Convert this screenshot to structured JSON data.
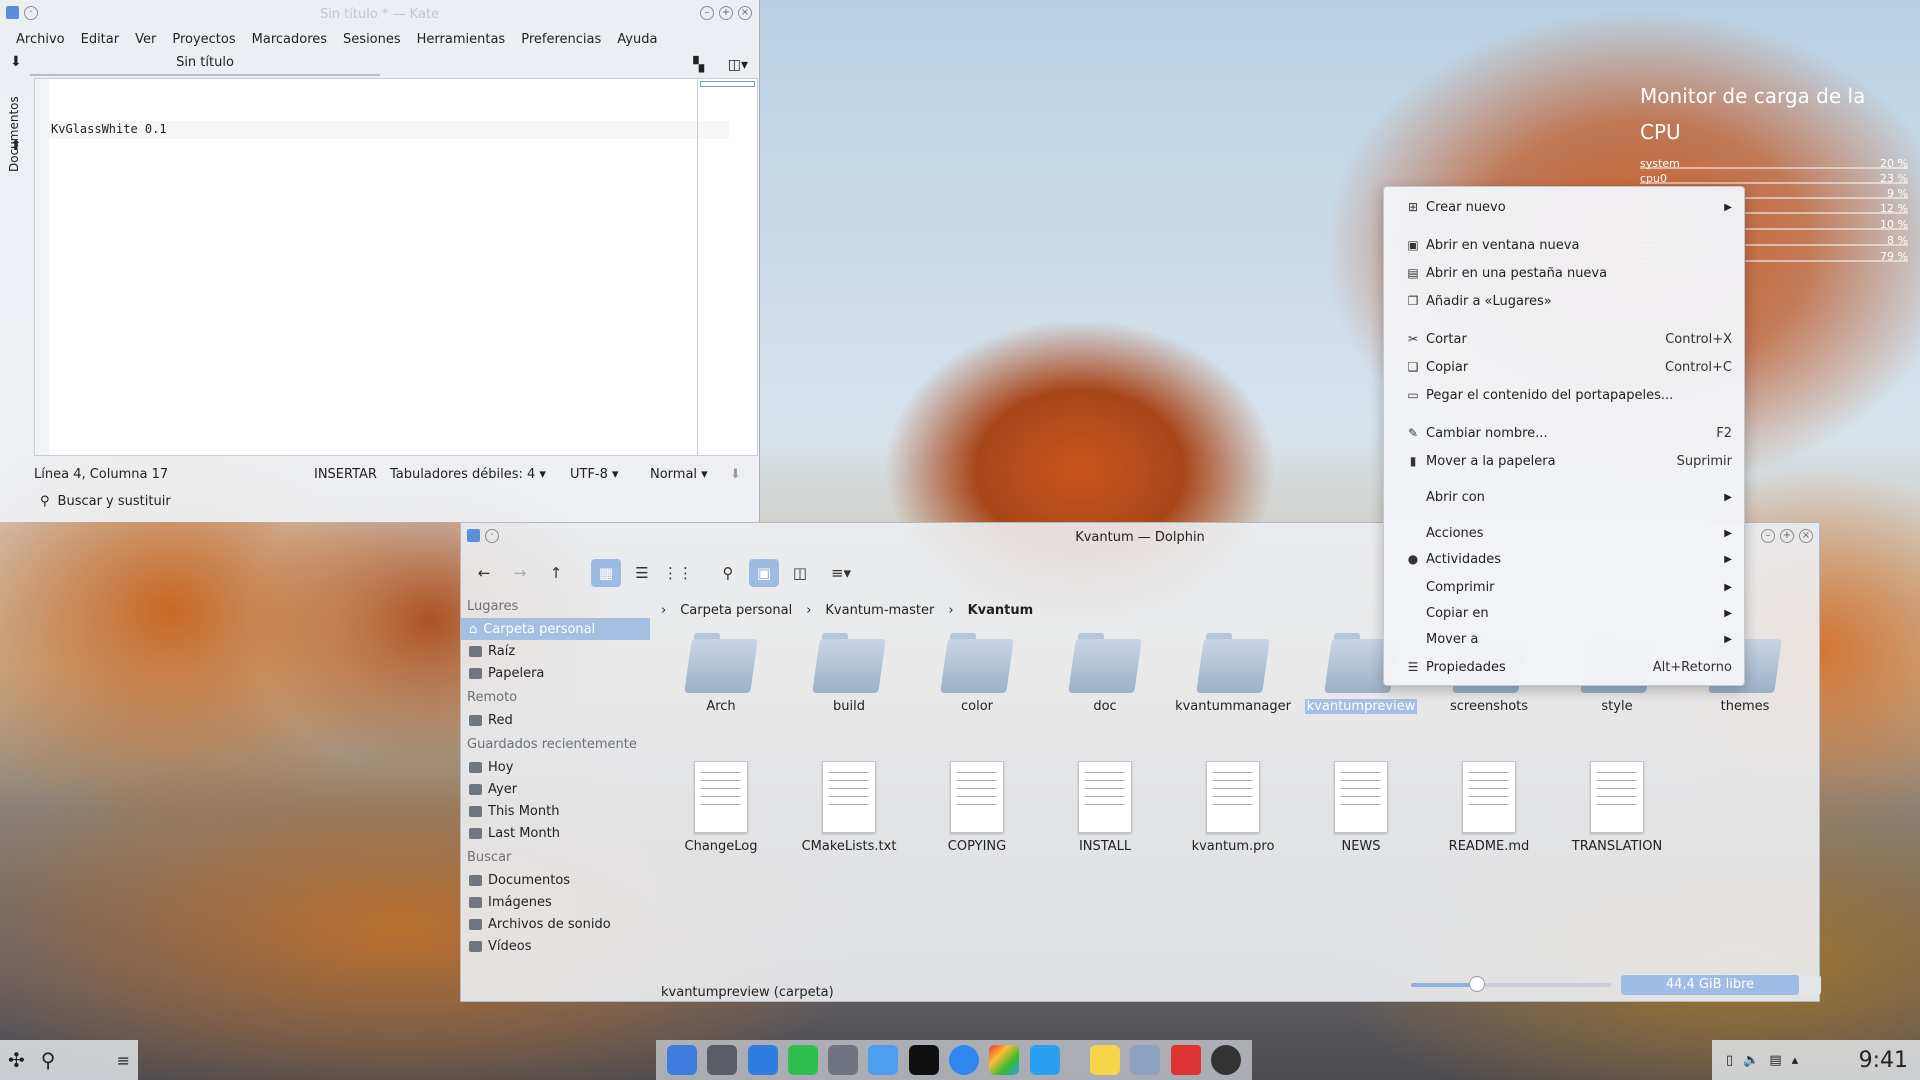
{
  "kate": {
    "title": "Sin título * — Kate",
    "menu": [
      "Archivo",
      "Editar",
      "Ver",
      "Proyectos",
      "Marcadores",
      "Sesiones",
      "Herramientas",
      "Preferencias",
      "Ayuda"
    ],
    "tab": "Sin título",
    "side_label": "Documentos",
    "code": "KvGlassWhite 0.1",
    "status": {
      "position": "Línea 4, Columna 17",
      "mode": "INSERTAR",
      "tabs": "Tabuladores débiles: 4",
      "encoding": "UTF-8",
      "syntax": "Normal"
    },
    "find": "Buscar y sustituir"
  },
  "dolphin": {
    "title": "Kvantum — Dolphin",
    "places": {
      "lugares_hdr": "Lugares",
      "lugares": [
        "Carpeta personal",
        "Raíz",
        "Papelera"
      ],
      "remoto_hdr": "Remoto",
      "remoto": [
        "Red"
      ],
      "recent_hdr": "Guardados recientemente",
      "recent": [
        "Hoy",
        "Ayer",
        "This Month",
        "Last Month"
      ],
      "buscar_hdr": "Buscar",
      "buscar": [
        "Documentos",
        "Imágenes",
        "Archivos de sonido",
        "Vídeos"
      ]
    },
    "breadcrumb": [
      "Carpeta personal",
      "Kvantum-master",
      "Kvantum"
    ],
    "folders": [
      "Arch",
      "build",
      "color",
      "doc",
      "kvantummanager",
      "kvantumpreview",
      "screenshots",
      "style",
      "themes"
    ],
    "files": [
      "ChangeLog",
      "CMakeLists.txt",
      "COPYING",
      "INSTALL",
      "kvantum.pro",
      "NEWS",
      "README.md",
      "TRANSLATION"
    ],
    "status": "kvantumpreview (carpeta)",
    "free": "44,4 GiB libre",
    "zoom_fraction": 0.33
  },
  "context_menu": {
    "items": [
      {
        "label": "Crear nuevo",
        "sub": true
      },
      {
        "label": "Abrir en ventana nueva"
      },
      {
        "label": "Abrir en una pestaña nueva"
      },
      {
        "label": "Añadir a «Lugares»"
      },
      {
        "label": "Cortar",
        "shortcut": "Control+X"
      },
      {
        "label": "Copiar",
        "shortcut": "Control+C"
      },
      {
        "label": "Pegar el contenido del portapapeles..."
      },
      {
        "label": "Cambiar nombre...",
        "shortcut": "F2"
      },
      {
        "label": "Mover a la papelera",
        "shortcut": "Suprimir"
      },
      {
        "label": "Abrir con",
        "sub": true
      },
      {
        "label": "Acciones",
        "sub": true
      },
      {
        "label": "Actividades",
        "sub": true
      },
      {
        "label": "Comprimir",
        "sub": true
      },
      {
        "label": "Copiar en",
        "sub": true
      },
      {
        "label": "Mover a",
        "sub": true
      },
      {
        "label": "Propiedades",
        "shortcut": "Alt+Retorno"
      }
    ]
  },
  "cpu_widget": {
    "title": "Monitor de carga de la CPU",
    "rows": [
      {
        "name": "system",
        "value": "20 %"
      },
      {
        "name": "cpu0",
        "value": "23 %"
      },
      {
        "value": "9 %"
      },
      {
        "value": "12 %"
      },
      {
        "value": "10 %"
      },
      {
        "value": "8 %"
      },
      {
        "value": "79 %"
      }
    ]
  },
  "taskbar": {
    "clock": "9:41"
  },
  "colors": {
    "accent": "#9fbbe3",
    "selection": "#a5bfe3"
  }
}
